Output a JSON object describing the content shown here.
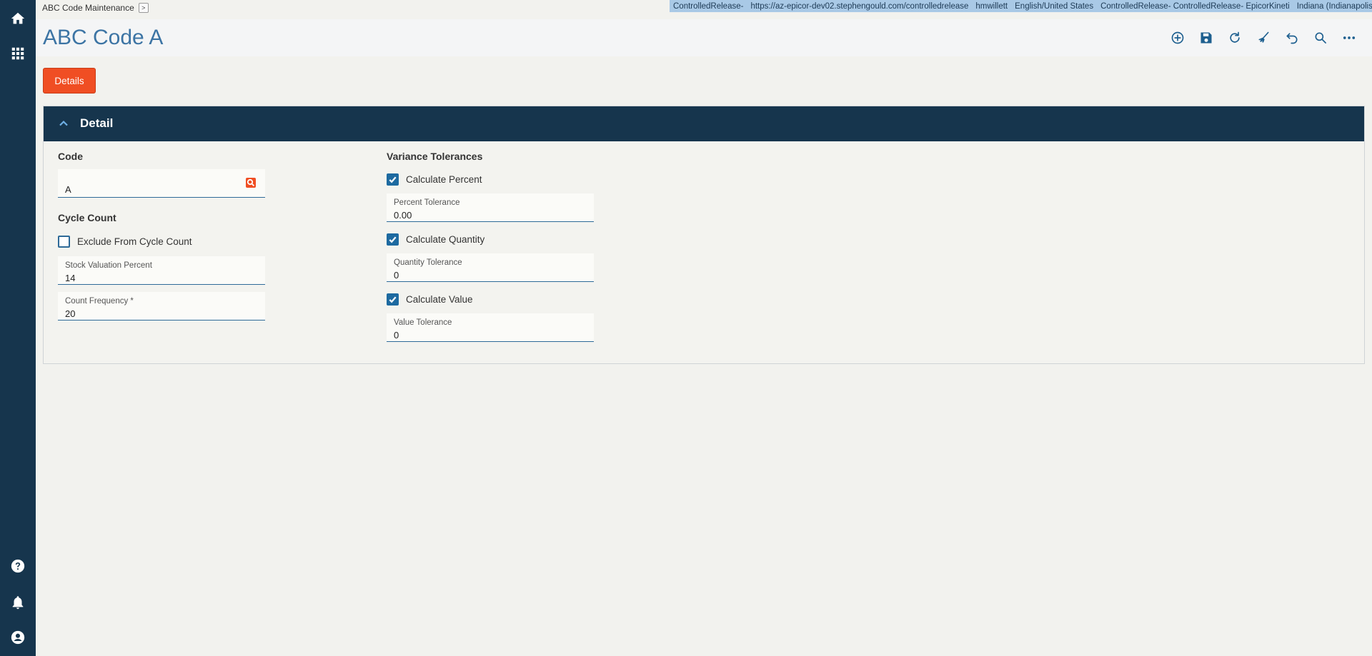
{
  "breadcrumb": {
    "label": "ABC Code Maintenance",
    "arrow": ">"
  },
  "status_bar": {
    "environment": "ControlledRelease-",
    "url": "https://az-epicor-dev02.stephengould.com/controlledrelease",
    "user": "hmwillett",
    "language": "English/United States",
    "company": "ControlledRelease- ControlledRelease- EpicorKineti",
    "site": "Indiana (Indianapolis)"
  },
  "page_title": "ABC Code A",
  "toolbar": {
    "icons": [
      "add-new-icon",
      "save-icon",
      "refresh-icon",
      "clear-icon",
      "undo-icon",
      "search-icon",
      "more-icon"
    ]
  },
  "details_button": "Details",
  "panel": {
    "title": "Detail",
    "code": {
      "label": "Code",
      "value": "A"
    },
    "cycle_count": {
      "label": "Cycle Count",
      "exclude_label": "Exclude From Cycle Count",
      "exclude_checked": false,
      "stock_valuation": {
        "label": "Stock Valuation Percent",
        "value": "14"
      },
      "count_frequency": {
        "label": "Count Frequency *",
        "value": "20"
      }
    },
    "variance": {
      "label": "Variance Tolerances",
      "calc_percent": {
        "label": "Calculate Percent",
        "checked": true
      },
      "percent_tolerance": {
        "label": "Percent Tolerance",
        "value": "0.00"
      },
      "calc_quantity": {
        "label": "Calculate Quantity",
        "checked": true
      },
      "quantity_tolerance": {
        "label": "Quantity Tolerance",
        "value": "0"
      },
      "calc_value": {
        "label": "Calculate Value",
        "checked": true
      },
      "value_tolerance": {
        "label": "Value Tolerance",
        "value": "0"
      }
    }
  },
  "colors": {
    "nav": "#16354d",
    "accent": "#f04e23",
    "title": "#3c74a4",
    "status": "#a9c9e6"
  }
}
